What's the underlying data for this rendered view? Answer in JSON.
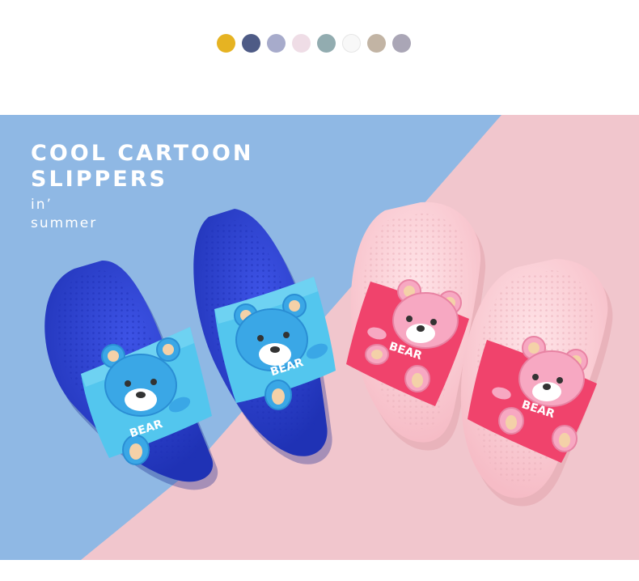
{
  "swatches": [
    {
      "name": "mustard",
      "color": "#e6b322"
    },
    {
      "name": "navy",
      "color": "#4e5b86"
    },
    {
      "name": "periwinkle",
      "color": "#a7abcb"
    },
    {
      "name": "blush",
      "color": "#efdde6"
    },
    {
      "name": "sage-blue",
      "color": "#92acb0"
    },
    {
      "name": "white",
      "color": "#f8f8f8"
    },
    {
      "name": "taupe",
      "color": "#c2b4a4"
    },
    {
      "name": "lavender-gray",
      "color": "#aaa6b6"
    }
  ],
  "banner": {
    "headline_line1": "COOL CARTOON",
    "headline_line2": "SLIPPERS",
    "sub_line1": "in’",
    "sub_line2": "summer",
    "bg_left": "#8fb8e4",
    "bg_right": "#f1c6cd"
  },
  "products": {
    "blue_pair": {
      "strap_text_left": "BEAR",
      "strap_text_right": "BEAR",
      "sole_color": "#2b3fd0",
      "strap_color": "#53c6ee"
    },
    "pink_pair": {
      "strap_text_left": "BEAR",
      "strap_text_right": "BEAR",
      "sole_color": "#fbd2d8",
      "strap_color": "#f0436c"
    }
  }
}
